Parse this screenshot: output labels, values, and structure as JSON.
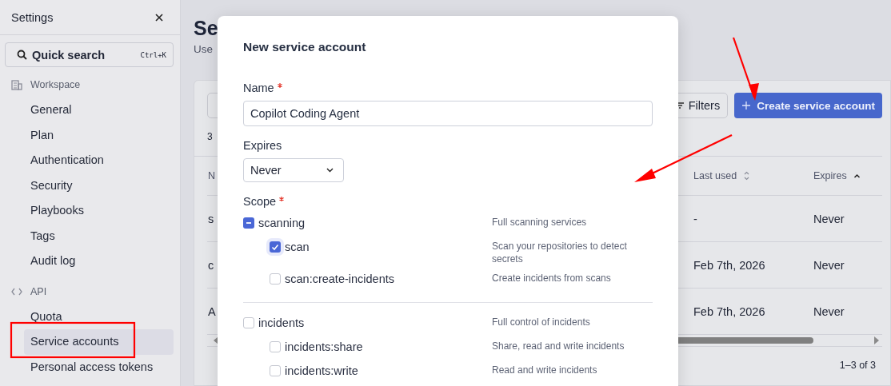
{
  "sidebar": {
    "title": "Settings",
    "search": {
      "label": "Quick search",
      "shortcut": "Ctrl+K"
    },
    "sections": [
      {
        "label": "Workspace",
        "items": [
          {
            "label": "General",
            "selected": false
          },
          {
            "label": "Plan",
            "selected": false
          },
          {
            "label": "Authentication",
            "selected": false
          },
          {
            "label": "Security",
            "selected": false
          },
          {
            "label": "Playbooks",
            "selected": false
          },
          {
            "label": "Tags",
            "selected": false
          },
          {
            "label": "Audit log",
            "selected": false
          }
        ]
      },
      {
        "label": "API",
        "items": [
          {
            "label": "Quota",
            "selected": false
          },
          {
            "label": "Service accounts",
            "selected": true
          },
          {
            "label": "Personal access tokens",
            "selected": false
          }
        ]
      }
    ]
  },
  "main": {
    "title": "Se",
    "subtitle": "Use",
    "filters_button": "Filters",
    "create_button": "Create service account",
    "count": "3",
    "columns": [
      {
        "label": "N"
      },
      {
        "label": "Last used",
        "sorted": false
      },
      {
        "label": "Expires",
        "sorted": true
      }
    ],
    "rows": [
      {
        "name": "s",
        "last_used": "-",
        "expires": "Never"
      },
      {
        "name": "c",
        "last_used": "Feb 7th, 2026",
        "expires": "Never"
      },
      {
        "name": "A",
        "last_used": "Feb 7th, 2026",
        "expires": "Never"
      }
    ],
    "pagination": "1–3 of 3"
  },
  "modal": {
    "title": "New service account",
    "name_field": {
      "label": "Name",
      "required": true,
      "value": "Copilot Coding Agent"
    },
    "expires_field": {
      "label": "Expires",
      "value": "Never"
    },
    "scope": {
      "label": "Scope",
      "required": true,
      "groups": [
        {
          "name": "scanning",
          "description": "Full scanning services",
          "partial": true,
          "children": [
            {
              "name": "scan",
              "description": "Scan your repositories to detect secrets",
              "checked": true,
              "focused": true
            },
            {
              "name": "scan:create-incidents",
              "description": "Create incidents from scans",
              "checked": false,
              "focused": false
            }
          ]
        },
        {
          "name": "incidents",
          "description": "Full control of incidents",
          "partial": false,
          "children": [
            {
              "name": "incidents:share",
              "description": "Share, read and write incidents",
              "checked": false,
              "focused": false
            },
            {
              "name": "incidents:write",
              "description": "Read and write incidents",
              "checked": false,
              "focused": false
            }
          ]
        }
      ]
    }
  }
}
